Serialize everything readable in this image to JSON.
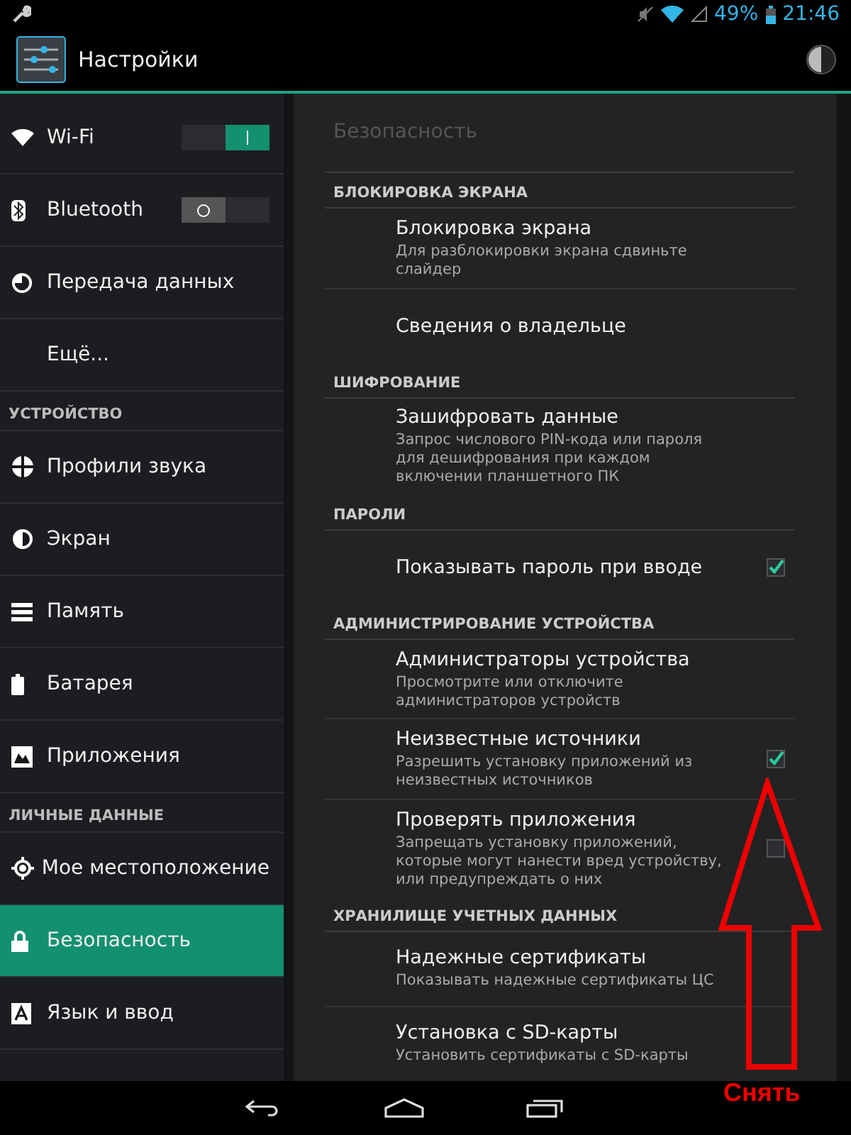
{
  "status_bar": {
    "battery": "49%",
    "time": "21:46"
  },
  "action_bar": {
    "title": "Настройки"
  },
  "sidebar": {
    "items": [
      {
        "kind": "toggle",
        "label": "Wi-Fi",
        "on": true,
        "selected": false
      },
      {
        "kind": "toggle",
        "label": "Bluetooth",
        "on": false,
        "selected": false
      },
      {
        "kind": "item",
        "label": "Передача данных",
        "selected": false
      },
      {
        "kind": "item",
        "label": "Ещё...",
        "selected": false
      },
      {
        "kind": "header",
        "label": "УСТРОЙСТВО"
      },
      {
        "kind": "item",
        "label": "Профили звука",
        "selected": false
      },
      {
        "kind": "item",
        "label": "Экран",
        "selected": false
      },
      {
        "kind": "item",
        "label": "Память",
        "selected": false
      },
      {
        "kind": "item",
        "label": "Батарея",
        "selected": false
      },
      {
        "kind": "item",
        "label": "Приложения",
        "selected": false
      },
      {
        "kind": "header",
        "label": "ЛИЧНЫЕ ДАННЫЕ"
      },
      {
        "kind": "item",
        "label": "Мое местоположение",
        "selected": false
      },
      {
        "kind": "item",
        "label": "Безопасность",
        "selected": true
      },
      {
        "kind": "item",
        "label": "Язык и ввод",
        "selected": false
      }
    ]
  },
  "page_title": "Безопасность",
  "sections": [
    {
      "header": "БЛОКИРОВКА ЭКРАНА",
      "items": [
        {
          "kind": "plain",
          "title": "Блокировка экрана",
          "summary": "Для разблокировки экрана сдвиньте слайдер"
        },
        {
          "kind": "plain",
          "title": "Сведения о владельце"
        }
      ]
    },
    {
      "header": "ШИФРОВАНИЕ",
      "items": [
        {
          "kind": "plain",
          "title": "Зашифровать данные",
          "summary": "Запрос числового PIN-кода или пароля для дешифрования при каждом включении планшетного ПК"
        }
      ]
    },
    {
      "header": "ПАРОЛИ",
      "items": [
        {
          "kind": "checkbox",
          "title": "Показывать пароль при вводе",
          "checked": true
        }
      ]
    },
    {
      "header": "АДМИНИСТРИРОВАНИЕ УСТРОЙСТВА",
      "items": [
        {
          "kind": "plain",
          "title": "Администраторы устройства",
          "summary": "Просмотрите или отключите администраторов устройств"
        },
        {
          "kind": "checkbox",
          "title": "Неизвестные источники",
          "summary": "Разрешить установку приложений из неизвестных источников",
          "checked": true
        },
        {
          "kind": "checkbox",
          "title": "Проверять приложения",
          "summary": "Запрещать установку приложений, которые могут нанести вред устройству, или предупреждать о них",
          "checked": false
        }
      ]
    },
    {
      "header": "ХРАНИЛИЩЕ УЧЕТНЫХ ДАННЫХ",
      "items": [
        {
          "kind": "plain",
          "title": "Надежные сертификаты",
          "summary": "Показывать надежные сертификаты ЦС"
        },
        {
          "kind": "plain",
          "title": "Установка с SD-карты",
          "summary": "Установить сертификаты с SD-карты"
        }
      ]
    }
  ],
  "annotation": {
    "label": "Снять"
  }
}
